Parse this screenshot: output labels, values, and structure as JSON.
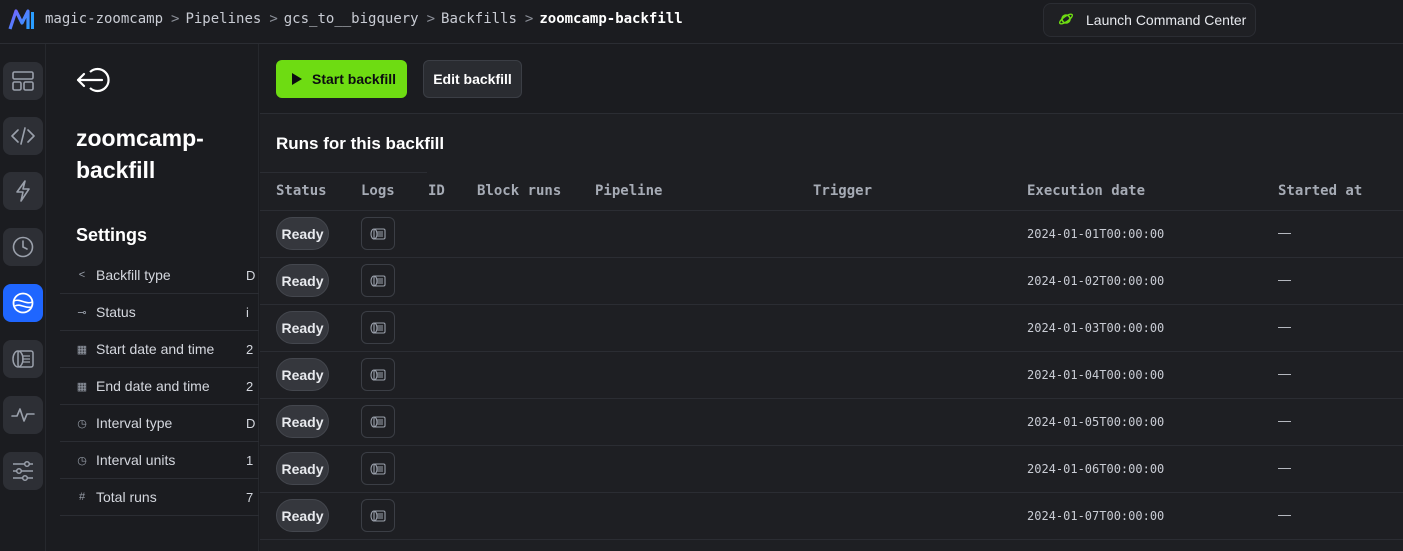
{
  "header": {
    "breadcrumbs": [
      "magic-zoomcamp",
      "Pipelines",
      "gcs_to__bigquery",
      "Backfills"
    ],
    "current": "zoomcamp-backfill",
    "separator": ">",
    "command_center_label": "Launch Command Center"
  },
  "rail": {
    "items": [
      "dashboard-icon",
      "code-icon",
      "lightning-icon",
      "clock-icon",
      "backfill-icon",
      "block-runs-icon",
      "monitor-icon",
      "settings-sliders-icon"
    ],
    "active": "backfill-icon"
  },
  "detail": {
    "title": "zoomcamp-backfill",
    "settings_heading": "Settings",
    "settings": [
      {
        "icon": "branch-icon",
        "label": "Backfill type",
        "value": "D"
      },
      {
        "icon": "status-icon",
        "label": "Status",
        "value": "i"
      },
      {
        "icon": "calendar-icon",
        "label": "Start date and time",
        "value": "2"
      },
      {
        "icon": "calendar-icon",
        "label": "End date and time",
        "value": "2"
      },
      {
        "icon": "clock-icon",
        "label": "Interval type",
        "value": "D"
      },
      {
        "icon": "clock-icon",
        "label": "Interval units",
        "value": "1"
      },
      {
        "icon": "hash-icon",
        "label": "Total runs",
        "value": "7"
      }
    ]
  },
  "toolbar": {
    "start_label": "Start backfill",
    "edit_label": "Edit backfill"
  },
  "runs": {
    "heading": "Runs for this backfill",
    "columns": [
      "Status",
      "Logs",
      "ID",
      "Block runs",
      "Pipeline",
      "Trigger",
      "Execution date",
      "Started at"
    ],
    "rows": [
      {
        "status": "Ready",
        "execution_date": "2024-01-01T00:00:00",
        "started_at": "—"
      },
      {
        "status": "Ready",
        "execution_date": "2024-01-02T00:00:00",
        "started_at": "—"
      },
      {
        "status": "Ready",
        "execution_date": "2024-01-03T00:00:00",
        "started_at": "—"
      },
      {
        "status": "Ready",
        "execution_date": "2024-01-04T00:00:00",
        "started_at": "—"
      },
      {
        "status": "Ready",
        "execution_date": "2024-01-05T00:00:00",
        "started_at": "—"
      },
      {
        "status": "Ready",
        "execution_date": "2024-01-06T00:00:00",
        "started_at": "—"
      },
      {
        "status": "Ready",
        "execution_date": "2024-01-07T00:00:00",
        "started_at": "—"
      }
    ]
  },
  "colors": {
    "accent_green": "#6edc12",
    "active_blue": "#1f66ff",
    "background": "#1b1c20"
  }
}
